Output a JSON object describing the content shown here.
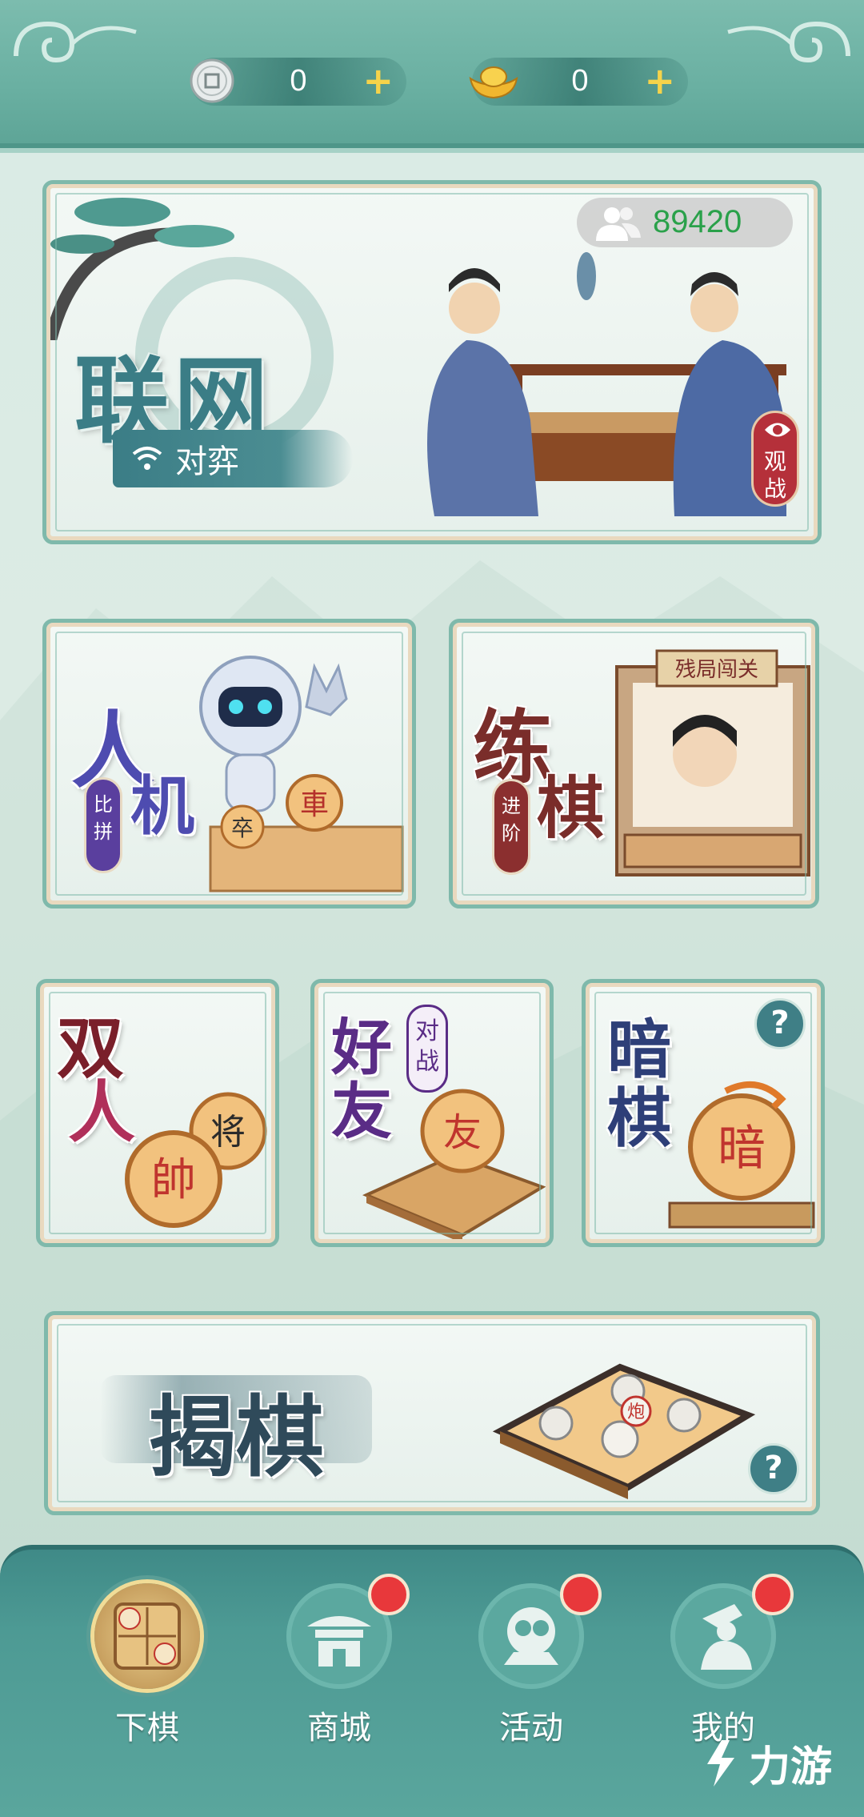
{
  "colors": {
    "primary_teal": "#6ab0a2",
    "accent_gold": "#f6d34a",
    "badge_red": "#e8383b",
    "online_green": "#2aa14a"
  },
  "currency": {
    "coins": {
      "icon": "coin-icon",
      "value": "0",
      "plus": "+"
    },
    "gold": {
      "icon": "gold-ingot-icon",
      "value": "0",
      "plus": "+"
    }
  },
  "online_mode": {
    "title": "联网",
    "subtitle": "对弈",
    "player_count": "89420",
    "watch_label_1": "观",
    "watch_label_2": "战"
  },
  "ai_mode": {
    "char1": "人",
    "char2": "机",
    "pill": "比拼",
    "piece": "車",
    "piece2": "卒"
  },
  "practice_mode": {
    "char1": "练",
    "char2": "棋",
    "pill": "进阶",
    "banner": "残局闯关"
  },
  "two_player_mode": {
    "char1": "双",
    "char2": "人",
    "piece1": "帥",
    "piece2": "将"
  },
  "friend_mode": {
    "char1": "好",
    "char2": "友",
    "tag": "对战",
    "piece": "友"
  },
  "dark_mode": {
    "char1": "暗",
    "char2": "棋",
    "piece": "暗",
    "help": "?"
  },
  "jieqi_mode": {
    "title": "揭棋",
    "piece": "炮",
    "help": "?"
  },
  "bottom_nav": [
    {
      "label": "下棋",
      "active": true
    },
    {
      "label": "商城",
      "active": false
    },
    {
      "label": "活动",
      "active": false
    },
    {
      "label": "我的",
      "active": false
    }
  ],
  "watermark": "力游"
}
